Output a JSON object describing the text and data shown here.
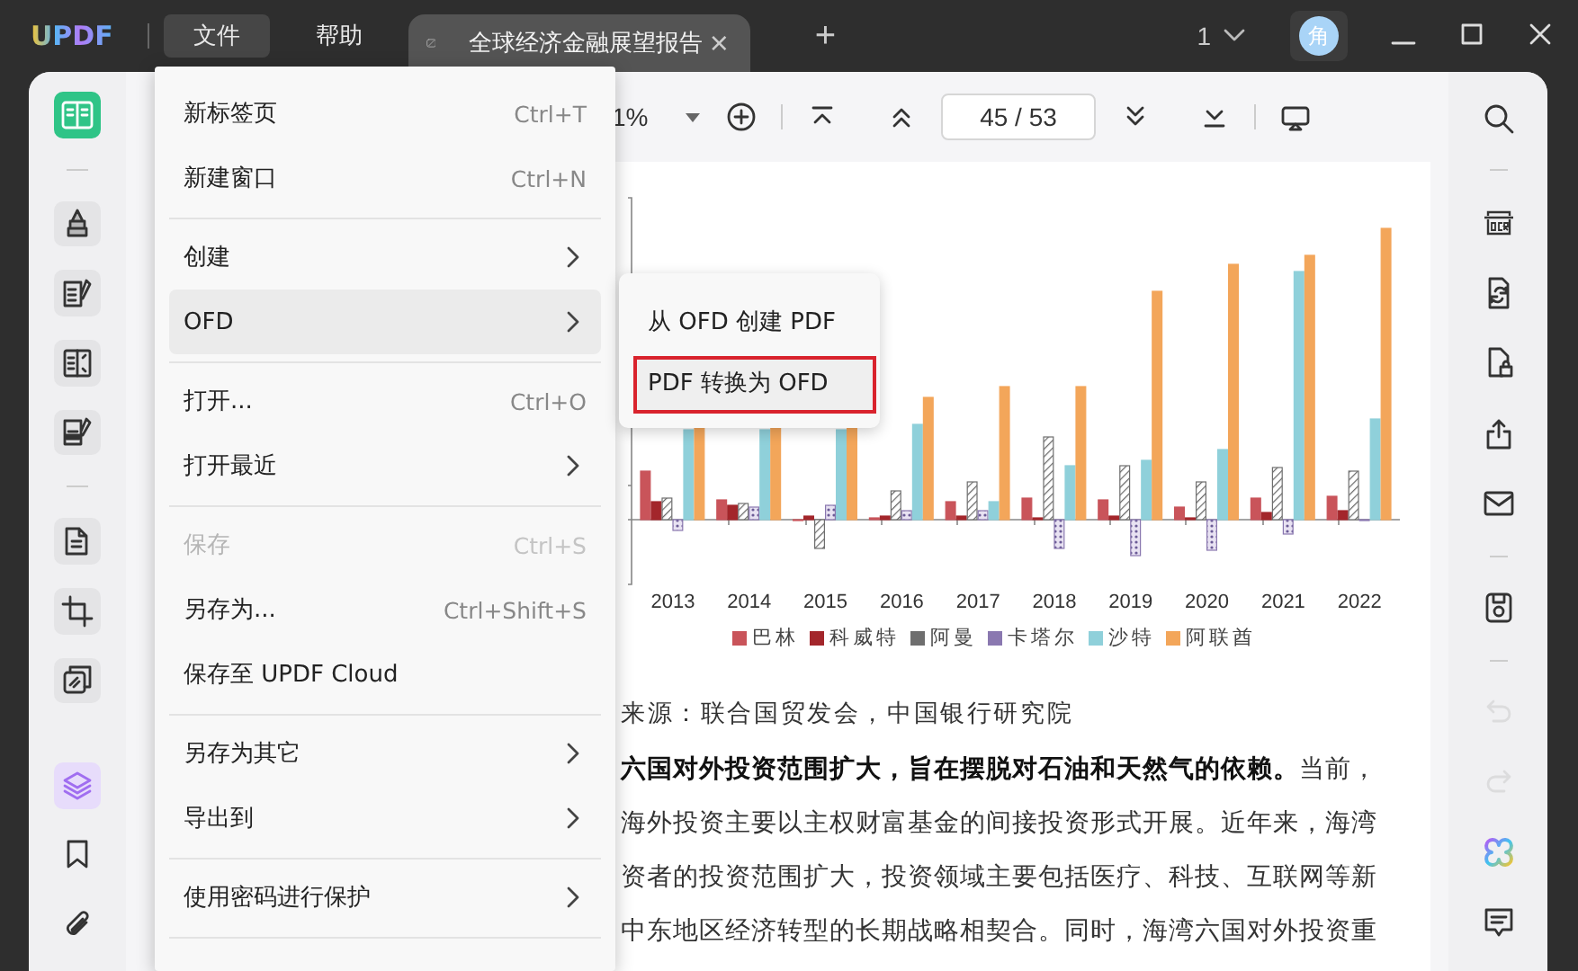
{
  "titlebar": {
    "logo": "UPDF",
    "menus": [
      {
        "label": "文件",
        "selected": true
      },
      {
        "label": "帮助",
        "selected": false
      }
    ],
    "tab": {
      "title": "全球经济金融展望报告",
      "close": "×"
    },
    "new_tab": "+",
    "count": "1",
    "avatar": "角"
  },
  "left_tools": [
    {
      "kind": "reader",
      "selected": true
    },
    {
      "kind": "divider"
    },
    {
      "kind": "comment",
      "selected": false
    },
    {
      "kind": "edit",
      "selected": false
    },
    {
      "kind": "form",
      "selected": false
    },
    {
      "kind": "sign",
      "selected": false
    },
    {
      "kind": "divider"
    },
    {
      "kind": "pages",
      "selected": false
    },
    {
      "kind": "crop",
      "selected": false
    },
    {
      "kind": "organize",
      "selected": false
    },
    {
      "kind": "spacer"
    },
    {
      "kind": "layers",
      "selected": true
    },
    {
      "kind": "bookmark",
      "selected": false
    },
    {
      "kind": "attachment",
      "selected": false
    }
  ],
  "toolbar": {
    "zoom": "1%",
    "page": "45 / 53"
  },
  "document": {
    "chart": {
      "years": [
        "2013",
        "2014",
        "2015",
        "2016",
        "2017",
        "2018",
        "2019",
        "2020",
        "2021",
        "2022"
      ],
      "legend": [
        {
          "label": "巴林",
          "color": "#c9545a"
        },
        {
          "label": "科威特",
          "color": "#a3262b"
        },
        {
          "label": "阿曼",
          "color": "#6e6e6e"
        },
        {
          "label": "卡塔尔",
          "color": "#8a78b0"
        },
        {
          "label": "沙特",
          "color": "#8fd0da"
        },
        {
          "label": "阿联酋",
          "color": "#f3a65a"
        }
      ]
    },
    "source": "来源：联合国贸发会，中国银行研究院",
    "lines": [
      "**六国对外投资范围扩大，旨在摆脱对石油和天然气的依赖。**当前，",
      "海外投资主要以主权财富基金的间接投资形式开展。近年来，海湾",
      "资者的投资范围扩大，投资领域主要包括医疗、科技、互联网等新",
      "中东地区经济转型的长期战略相契合。同时，海湾六国对外投资重"
    ]
  },
  "right_tools": [
    {
      "kind": "search",
      "disabled": false
    },
    {
      "kind": "divider"
    },
    {
      "kind": "ocr",
      "disabled": false
    },
    {
      "kind": "convert",
      "disabled": false
    },
    {
      "kind": "protect",
      "disabled": false
    },
    {
      "kind": "share",
      "disabled": false
    },
    {
      "kind": "email",
      "disabled": false
    },
    {
      "kind": "divider"
    },
    {
      "kind": "save",
      "disabled": false
    },
    {
      "kind": "divider"
    },
    {
      "kind": "undo",
      "disabled": true
    },
    {
      "kind": "redo",
      "disabled": true
    },
    {
      "kind": "ai",
      "disabled": false
    },
    {
      "kind": "comment",
      "disabled": false
    }
  ],
  "file_menu": {
    "items": [
      {
        "kind": "item",
        "label": "新标签页",
        "shortcut": "Ctrl+T",
        "submenu": false,
        "disabled": false,
        "selected": false
      },
      {
        "kind": "item",
        "label": "新建窗口",
        "shortcut": "Ctrl+N",
        "submenu": false,
        "disabled": false,
        "selected": false
      },
      {
        "kind": "separator"
      },
      {
        "kind": "item",
        "label": "创建",
        "submenu": true,
        "disabled": false,
        "selected": false
      },
      {
        "kind": "item",
        "label": "OFD",
        "submenu": true,
        "disabled": false,
        "selected": true
      },
      {
        "kind": "separator"
      },
      {
        "kind": "item",
        "label": "打开...",
        "shortcut": "Ctrl+O",
        "submenu": false,
        "disabled": false,
        "selected": false
      },
      {
        "kind": "item",
        "label": "打开最近",
        "submenu": true,
        "disabled": false,
        "selected": false
      },
      {
        "kind": "separator"
      },
      {
        "kind": "item",
        "label": "保存",
        "shortcut": "Ctrl+S",
        "submenu": false,
        "disabled": true,
        "selected": false
      },
      {
        "kind": "item",
        "label": "另存为...",
        "shortcut": "Ctrl+Shift+S",
        "submenu": false,
        "disabled": false,
        "selected": false
      },
      {
        "kind": "item",
        "label": "保存至 UPDF Cloud",
        "submenu": false,
        "disabled": false,
        "selected": false
      },
      {
        "kind": "separator"
      },
      {
        "kind": "item",
        "label": "另存为其它",
        "submenu": true,
        "disabled": false,
        "selected": false
      },
      {
        "kind": "item",
        "label": "导出到",
        "submenu": true,
        "disabled": false,
        "selected": false
      },
      {
        "kind": "separator"
      },
      {
        "kind": "item",
        "label": "使用密码进行保护",
        "submenu": true,
        "disabled": false,
        "selected": false
      },
      {
        "kind": "separator"
      }
    ]
  },
  "submenu": {
    "items": [
      {
        "label": "从 OFD 创建 PDF",
        "selected": false
      },
      {
        "label": "PDF 转换为 OFD",
        "selected": true
      }
    ]
  }
}
